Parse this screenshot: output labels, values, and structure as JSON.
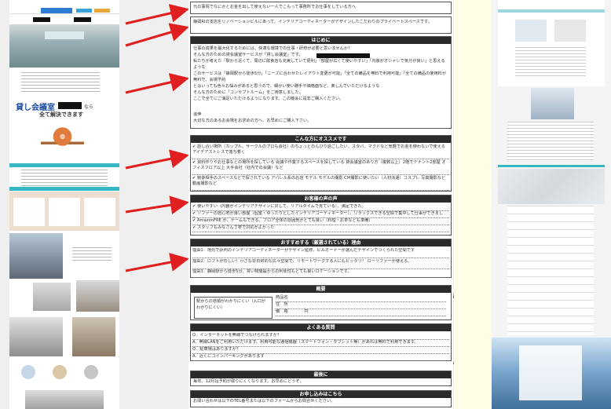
{
  "doc": {
    "intro_box": "元の事情でなにかとお金を出して使えない一人でこもって事務所でお仕事をしている方へ",
    "intro_box2": "静岡RIの支店をリノベーションビルにあって、インテリアコーディネーターがデザインしたこだわりのプライベートスペースです。",
    "hajimeni": {
      "header": "はじめに",
      "lines": [
        "仕事の成果を最大化するためには、快適な環境での仕事・研修が必要と思いませんか？",
        "そんな方のための貸会議室サービスが「貸し会議室」です。",
        "私たちが考えた「駅から近くて、周辺に飲食店も充実していて便利」「部屋が広くて使いやすい」「内装がオシャレで気分が良い」と思えるような",
        "このサービスは「静岡駅から徒歩5分」「ニーズに合わせたレイアウト変更が可能」「全ての備品を無料で利用可能」「全ての備品の使用料が無料で、会場予約",
        "とはいっても色々お悩みがあると思うので、細かい使い勝手や価格面など、楽しんでいただけるような",
        "そんな方のために「コンセプトルーム」をご用意しました。",
        "ここで全てにご満足いただけるようになります。この機会に是非ご購入ください。",
        "",
        "追伸",
        "大切な方のあるお会場をお求めの方へ、お早めにご購入下さい。"
      ]
    },
    "recommend": {
      "header": "こんな方にオススメです",
      "items": [
        "話し合い場所（カップル、サークルのプロも会社）のちょっとのんびり過ごしたい、スタバ、マクドなど気軽でお金を使わないで使えるアイデアストレスで落ち着く",
        "資料作りやお仕事などの場所を探している 会議や作業するスペースを探している 貸会議室のあり方（複数以上）2階でテナント2部屋 オフィスフロア以上 大手会社（社内での会議）など",
        "競争相手のスペースなどで探されている アパレル系のお店 モデル モデルの撮影 CM撮影に使いたい（人材派遣）コスプレ 写真撮影など 動画撮影など"
      ]
    },
    "voice": {
      "header": "お客様の声の声",
      "items": [
        "使いやすい（内観がインテリアデザインに対して、リアルタイムで見ている）、満足できた。",
        "ソファーの居心地が良い部屋（個室・ゆったりとしたインテリアコーディネーター）、リラックスできる空間で集中して仕事ができました。",
        "AmazonFRE が、ゲームもできる、フロア全体の雰囲気がとても良い（料理・お茶なども準備）",
        "スタッフもみなさん丁寧で対応がよかった"
      ]
    },
    "features": {
      "header": "おすすめする（厳選されている）理由",
      "items": [
        "理由1：地元で評判のインテリアコーディネーターがデザイン監修、ビルオーナーが選んだデザインでつくられた空間です",
        "理由2：ロフトが珍しい！小さな非日常的な広々空間で、リモートワークする人にもピッタリ！ ローソファーが使える。",
        "理由3：静岡駅から徒歩5分、買い物施設からの利便性もとても良いロケーションです。"
      ]
    },
    "summary": {
      "header": "概要",
      "left_text": "駅からの道順がわかりにくい（入口がわかりにくい）",
      "right_rows": [
        "商品名",
        "住　所",
        "価　格　　　　円"
      ]
    },
    "faq": {
      "header": "よくある質問",
      "items": [
        "Q．インターネットを無線でつなげられますか？",
        "A．無線LANをご利用いただけます。利用可能な通信機器（スマートフォン・タブレット等）があれば無料で利用できます。",
        "Q．駐車場はありますか？",
        "A．近くにコインパーキングがあります"
      ]
    },
    "last": {
      "header": "最後に",
      "text": "毎年、12月は予約が取りにくくなります。お早めにどうぞ。"
    },
    "contact": {
      "header": "お申し込みはこちら",
      "text": "お問い合わせは以下のTEL番号または以下のフォームからお問合せください。"
    }
  },
  "left_panel": {
    "banner_text": "貸し会議室",
    "banner_sub": "全て解決できます",
    "banner_suffix": "なら"
  },
  "colors": {
    "arrow": "#e02020",
    "header_bg": "#2b2b2b",
    "teal": "#37b7c3"
  }
}
